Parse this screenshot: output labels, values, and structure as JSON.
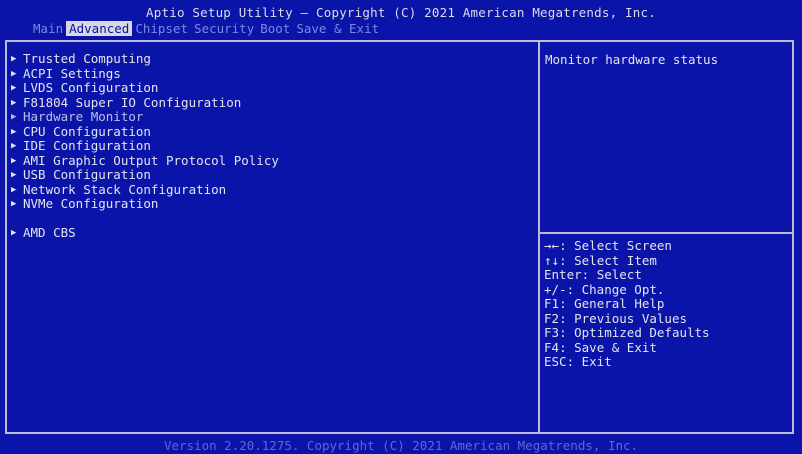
{
  "header": {
    "title": "Aptio Setup Utility – Copyright (C) 2021 American Megatrends, Inc."
  },
  "menu": {
    "items": [
      {
        "label": "Main"
      },
      {
        "label": "Advanced",
        "active": true
      },
      {
        "label": "Chipset"
      },
      {
        "label": "Security"
      },
      {
        "label": "Boot"
      },
      {
        "label": "Save & Exit"
      }
    ]
  },
  "left_panel": {
    "arrow_icon": "▶",
    "items": [
      {
        "label": "Trusted Computing"
      },
      {
        "label": "ACPI Settings"
      },
      {
        "label": "LVDS Configuration"
      },
      {
        "label": "F81804 Super IO Configuration"
      },
      {
        "label": "Hardware Monitor",
        "selected": true
      },
      {
        "label": "CPU Configuration"
      },
      {
        "label": "IDE Configuration"
      },
      {
        "label": "AMI Graphic Output Protocol Policy"
      },
      {
        "label": "USB Configuration"
      },
      {
        "label": "Network Stack Configuration"
      },
      {
        "label": "NVMe Configuration"
      }
    ],
    "extra_items": [
      {
        "label": "AMD CBS"
      }
    ]
  },
  "help": {
    "text": "Monitor hardware status"
  },
  "keys": [
    {
      "key": "→←",
      "desc": ": Select Screen"
    },
    {
      "key": "↑↓",
      "desc": ": Select Item"
    },
    {
      "key": "Enter",
      "desc": ": Select"
    },
    {
      "key": "+/-",
      "desc": ": Change Opt."
    },
    {
      "key": "F1",
      "desc": ": General Help"
    },
    {
      "key": "F2",
      "desc": ": Previous Values"
    },
    {
      "key": "F3",
      "desc": ": Optimized Defaults"
    },
    {
      "key": "F4",
      "desc": ": Save & Exit"
    },
    {
      "key": "ESC",
      "desc": ": Exit"
    }
  ],
  "footer": {
    "text": "Version 2.20.1275. Copyright (C) 2021 American Megatrends, Inc."
  },
  "colors": {
    "background": "#0b14a8",
    "border": "#b8bcd8",
    "menu_inactive": "#7d86e8",
    "menu_active_bg": "#d8d8df",
    "text": "#e4e4ee",
    "footer_text": "#5d68d8"
  }
}
